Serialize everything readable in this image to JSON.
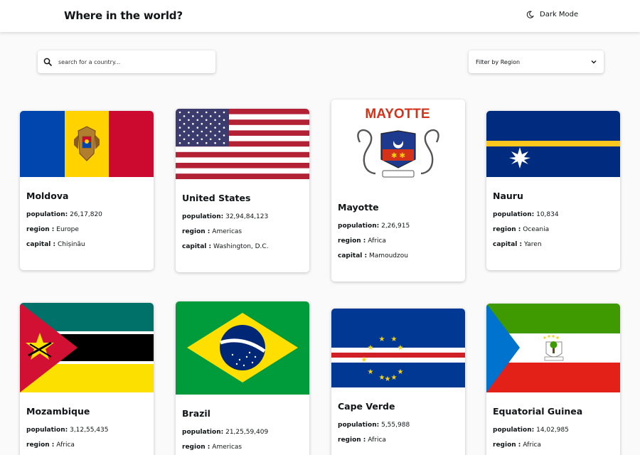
{
  "header": {
    "title": "Where in the world?",
    "mode_label": "Dark Mode"
  },
  "search": {
    "placeholder": "search for a country..."
  },
  "filter": {
    "label": "Filter by Region"
  },
  "labels": {
    "population": "population:",
    "region": "region :",
    "capital": "capital :"
  },
  "countries": [
    {
      "name": "Moldova",
      "population": "26,17,820",
      "region": "Europe",
      "capital": "Chișinău",
      "flag": "moldova-flag"
    },
    {
      "name": "United States",
      "population": "32,94,84,123",
      "region": "Americas",
      "capital": "Washington, D.C.",
      "flag": "us-flag"
    },
    {
      "name": "Mayotte",
      "population": "2,26,915",
      "region": "Africa",
      "capital": "Mamoudzou",
      "flag": "mayotte-flag",
      "flag_text": "MAYOTTE"
    },
    {
      "name": "Nauru",
      "population": "10,834",
      "region": "Oceania",
      "capital": "Yaren",
      "flag": "nauru-flag"
    },
    {
      "name": "Mozambique",
      "population": "3,12,55,435",
      "region": "Africa",
      "flag": "mozambique-flag"
    },
    {
      "name": "Brazil",
      "population": "21,25,59,409",
      "region": "Americas",
      "flag": "brazil-flag"
    },
    {
      "name": "Cape Verde",
      "population": "5,55,988",
      "region": "Africa",
      "flag": "cape-verde-flag"
    },
    {
      "name": "Equatorial Guinea",
      "population": "14,02,985",
      "region": "Africa",
      "flag": "equatorial-guinea-flag"
    }
  ]
}
